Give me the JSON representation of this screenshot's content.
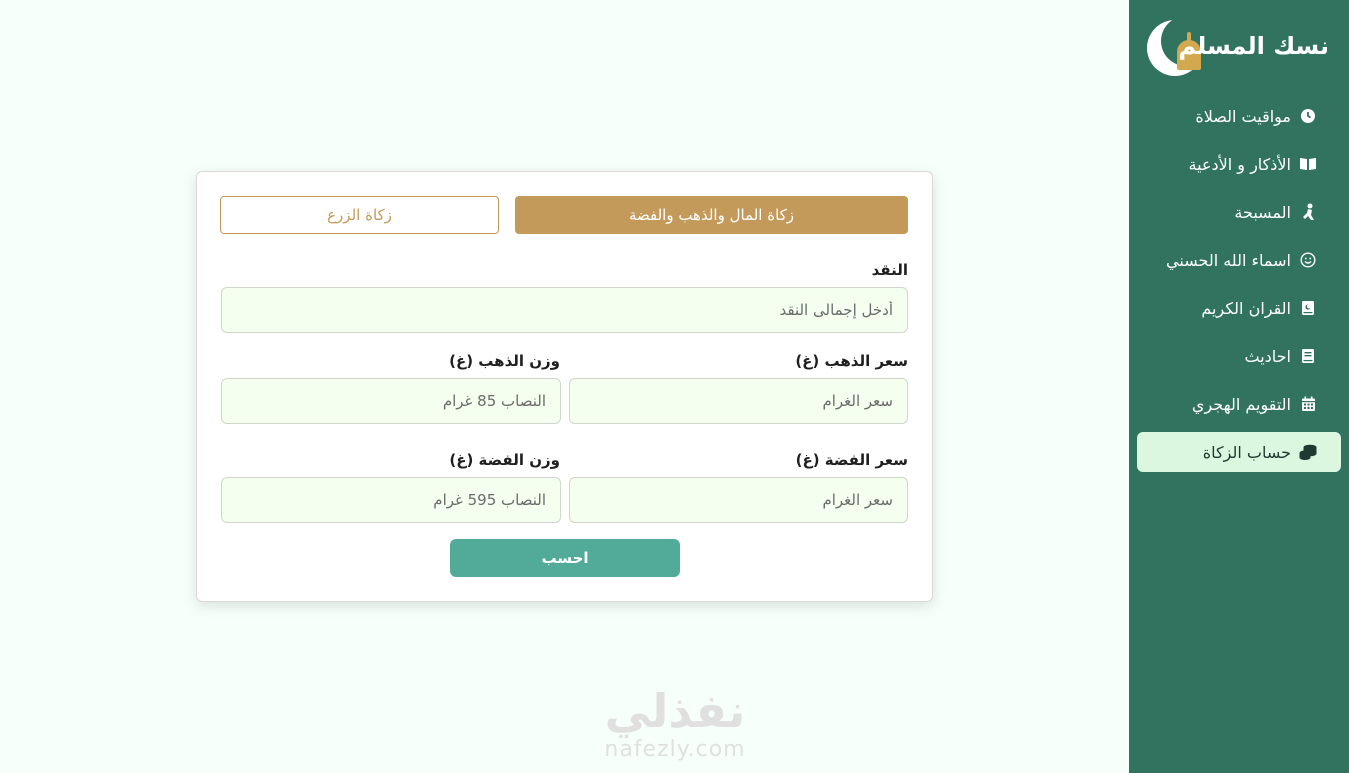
{
  "sidebar": {
    "logo_text": "نسك المسلم",
    "items": [
      {
        "label": "مواقيت الصلاة",
        "icon": "clock-icon"
      },
      {
        "label": "الأذكار و الأدعية",
        "icon": "open-book-icon"
      },
      {
        "label": "المسبحة",
        "icon": "praying-person-icon"
      },
      {
        "label": "اسماء الله الحسني",
        "icon": "smiley-icon"
      },
      {
        "label": "القران الكريم",
        "icon": "quran-book-icon"
      },
      {
        "label": "احاديث",
        "icon": "book-icon"
      },
      {
        "label": "التقويم الهجري",
        "icon": "calendar-icon"
      },
      {
        "label": "حساب الزكاة",
        "icon": "coins-icon",
        "active": true
      }
    ]
  },
  "zakat": {
    "tabs": {
      "money": "زكاة المال والذهب والفضة",
      "crops": "زكاة الزرع"
    },
    "cash": {
      "label": "النقد",
      "placeholder": "أدخل إجمالى النقد"
    },
    "gold_price": {
      "label": "سعر الذهب (غ)",
      "placeholder": "سعر الغرام"
    },
    "gold_weight": {
      "label": "وزن الذهب (غ)",
      "placeholder": "النصاب 85 غرام"
    },
    "silver_price": {
      "label": "سعر الفضة (غ)",
      "placeholder": "سعر الغرام"
    },
    "silver_weight": {
      "label": "وزن الفضة (غ)",
      "placeholder": "النصاب 595 غرام"
    },
    "calculate_label": "احسب"
  },
  "watermark": {
    "arabic": "نفذلي",
    "latin": "nafezly.com"
  },
  "colors": {
    "sidebar_bg": "#31735f",
    "active_item_bg": "#dbf7df",
    "accent_gold": "#c49a5a",
    "button_green": "#52ab98",
    "input_bg": "#f4ffef"
  }
}
